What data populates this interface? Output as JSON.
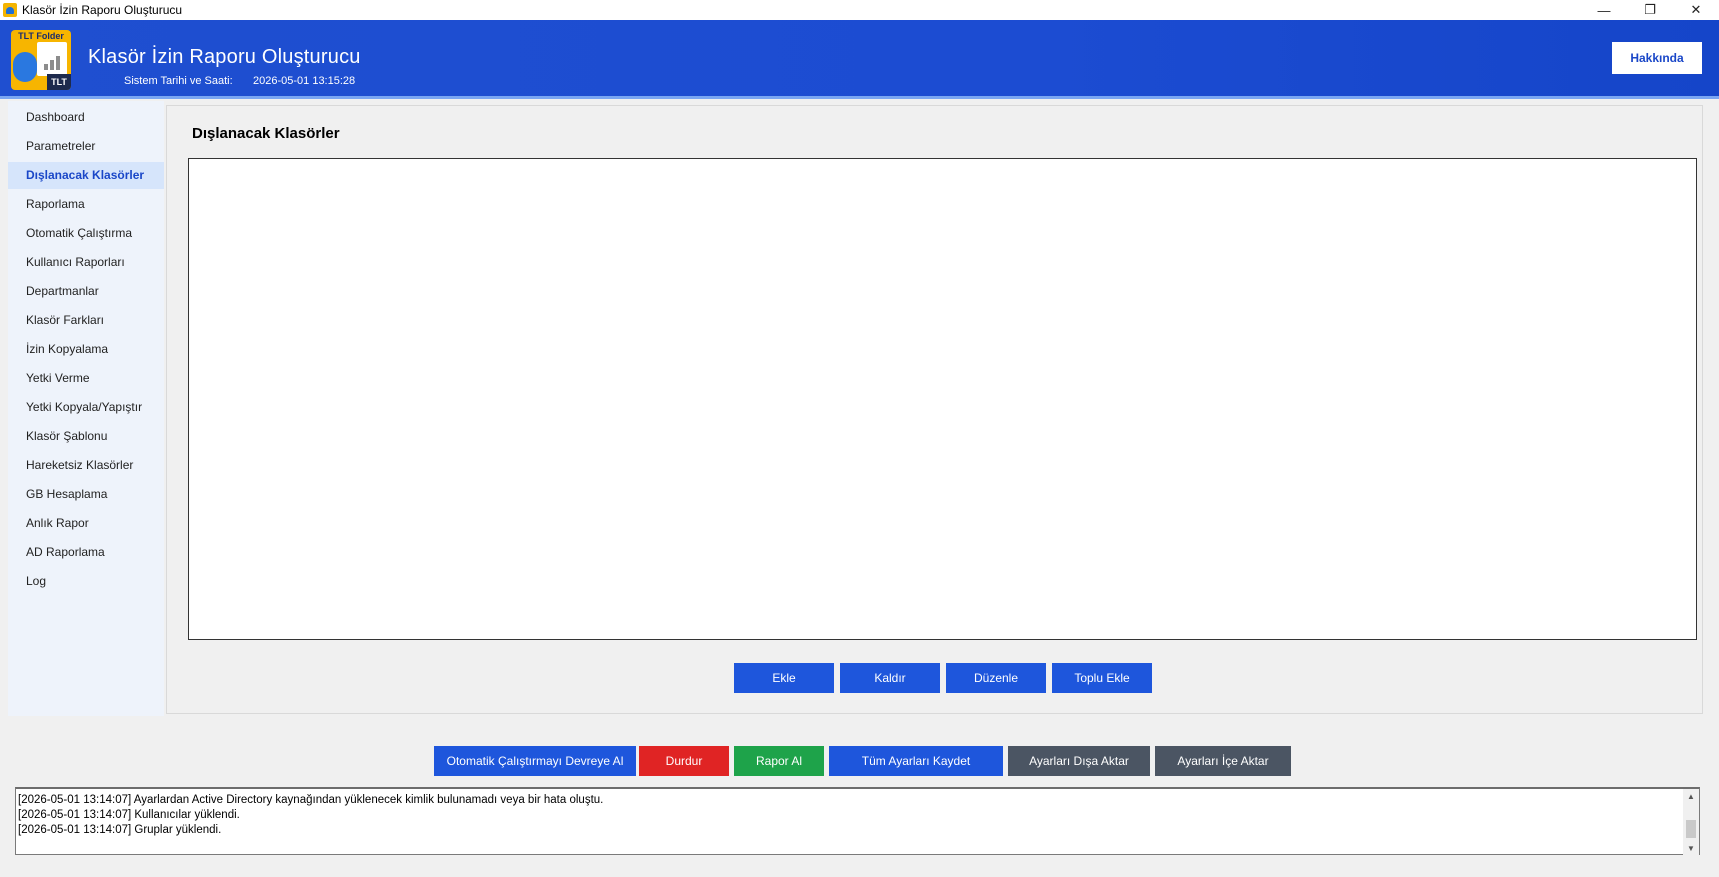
{
  "window": {
    "title": "Klasör İzin Raporu Oluşturucu",
    "controls": {
      "minimize": "—",
      "maximize": "❐",
      "close": "✕"
    }
  },
  "header": {
    "logo_top_text": "TLT Folder",
    "logo_badge_text": "TLT",
    "app_title": "Klasör İzin Raporu Oluşturucu",
    "system_time_label": "Sistem Tarihi ve Saati:",
    "system_time_value": "2026-05-01 13:15:28",
    "about_label": "Hakkında"
  },
  "sidebar": {
    "active_index": 2,
    "items": [
      {
        "label": "Dashboard"
      },
      {
        "label": "Parametreler"
      },
      {
        "label": "Dışlanacak Klasörler"
      },
      {
        "label": "Raporlama"
      },
      {
        "label": "Otomatik Çalıştırma"
      },
      {
        "label": "Kullanıcı Raporları"
      },
      {
        "label": "Departmanlar"
      },
      {
        "label": "Klasör Farkları"
      },
      {
        "label": "İzin Kopyalama"
      },
      {
        "label": "Yetki Verme"
      },
      {
        "label": "Yetki Kopyala/Yapıştır"
      },
      {
        "label": "Klasör Şablonu"
      },
      {
        "label": "Hareketsiz Klasörler"
      },
      {
        "label": "GB Hesaplama"
      },
      {
        "label": "Anlık Rapor"
      },
      {
        "label": "AD Raporlama"
      },
      {
        "label": "Log"
      }
    ]
  },
  "main": {
    "title": "Dışlanacak Klasörler",
    "list_items": [],
    "buttons": {
      "add": "Ekle",
      "remove": "Kaldır",
      "edit": "Düzenle",
      "bulk_add": "Toplu Ekle"
    }
  },
  "footer": {
    "buttons": {
      "enable_auto_run": "Otomatik Çalıştırmayı Devreye Al",
      "stop": "Durdur",
      "get_report": "Rapor Al",
      "save_all_settings": "Tüm Ayarları Kaydet",
      "export_settings": "Ayarları Dışa Aktar",
      "import_settings": "Ayarları İçe Aktar"
    },
    "colors": {
      "primary": "#1e56dc",
      "danger": "#e02424",
      "success": "#1ea34a",
      "neutral": "#4b5563"
    }
  },
  "log": {
    "lines": [
      "[2026-05-01 13:14:07] Ayarlardan Active Directory kaynağından yüklenecek kimlik bulunamadı veya bir hata oluştu.",
      "[2026-05-01 13:14:07] Kullanıcılar yüklendi.",
      "[2026-05-01 13:14:07] Gruplar yüklendi."
    ]
  }
}
